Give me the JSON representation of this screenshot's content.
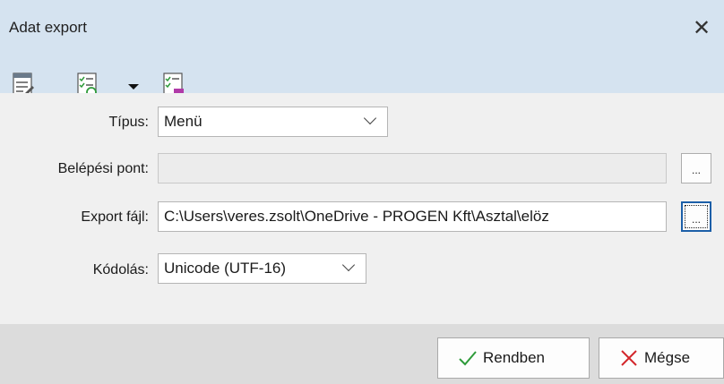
{
  "window": {
    "title": "Adat export"
  },
  "toolbar": {
    "icons": [
      "list-edit-icon",
      "checklist-refresh-icon",
      "dropdown-arrow-icon",
      "checklist-purple-icon"
    ]
  },
  "form": {
    "tipus": {
      "label": "Típus:",
      "value": "Menü"
    },
    "belepesi_pont": {
      "label": "Belépési pont:",
      "value": ""
    },
    "export_fajl": {
      "label": "Export fájl:",
      "value": "C:\\Users\\veres.zsolt\\OneDrive - PROGEN Kft\\Asztal\\elöz"
    },
    "kodolas": {
      "label": "Kódolás:",
      "value": "Unicode (UTF-16)"
    },
    "browse_label": "..."
  },
  "buttons": {
    "ok": "Rendben",
    "cancel": "Mégse"
  },
  "colors": {
    "titlebar": "#d5e3f0",
    "ok_check": "#2e9b3a",
    "cancel_x": "#d3262b",
    "focus_border": "#1c5fa8"
  }
}
